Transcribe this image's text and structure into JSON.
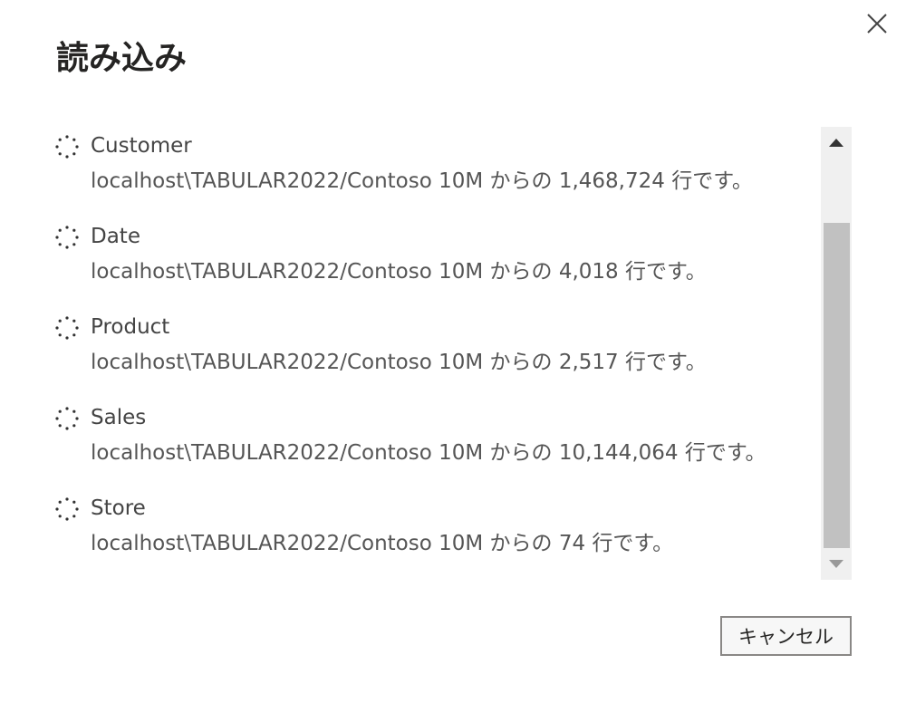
{
  "dialog": {
    "title": "読み込み",
    "cancel_label": "キャンセル"
  },
  "items": [
    {
      "name": "Customer",
      "desc": "localhost\\TABULAR2022/Contoso 10M からの 1,468,724 行です。"
    },
    {
      "name": "Date",
      "desc": "localhost\\TABULAR2022/Contoso 10M からの 4,018 行です。"
    },
    {
      "name": "Product",
      "desc": "localhost\\TABULAR2022/Contoso 10M からの 2,517 行です。"
    },
    {
      "name": "Sales",
      "desc": "localhost\\TABULAR2022/Contoso 10M からの 10,144,064 行です。"
    },
    {
      "name": "Store",
      "desc": "localhost\\TABULAR2022/Contoso 10M からの 74 行です。"
    }
  ],
  "icons": {
    "close": "close-icon",
    "spinner": "loading-spinner-icon",
    "scroll_up": "triangle-up-icon",
    "scroll_down": "triangle-down-icon"
  },
  "colors": {
    "title": "#252423",
    "text": "#555555",
    "scroll_track": "#f0f0f0",
    "scroll_thumb": "#c1c1c1"
  }
}
